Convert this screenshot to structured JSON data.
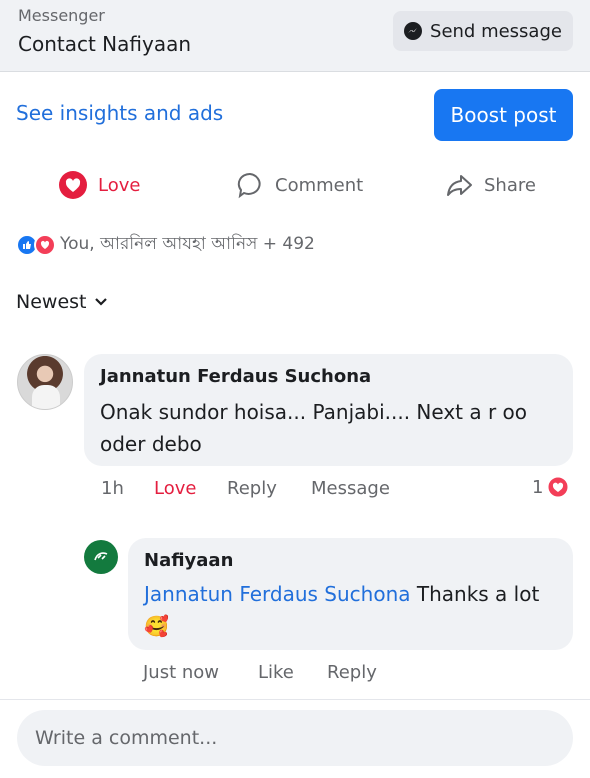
{
  "header": {
    "small_label": "Messenger",
    "contact_label": "Contact Nafiyaan",
    "send_message_label": "Send message"
  },
  "promo": {
    "insights_label": "See insights and ads",
    "boost_label": "Boost post"
  },
  "actions": {
    "love": "Love",
    "comment": "Comment",
    "share": "Share"
  },
  "reactions": {
    "summary": "You, আরনিল আযহা আনিস + 492"
  },
  "sort": {
    "label": "Newest"
  },
  "comments": [
    {
      "author": "Jannatun Ferdaus Suchona",
      "text": "Onak sundor hoisa... Panjabi.... Next a r oo oder debo",
      "time": "1h",
      "love": "Love",
      "reply": "Reply",
      "message": "Message",
      "reaction_count": "1"
    },
    {
      "author": "Nafiyaan",
      "mention": "Jannatun Ferdaus Suchona",
      "text": " Thanks a lot🥰",
      "time": "Just now",
      "like": "Like",
      "reply": "Reply"
    }
  ],
  "composer": {
    "placeholder": "Write a comment..."
  },
  "colors": {
    "accent": "#1877f2",
    "love": "#e41e3f",
    "link": "#216fdb"
  }
}
